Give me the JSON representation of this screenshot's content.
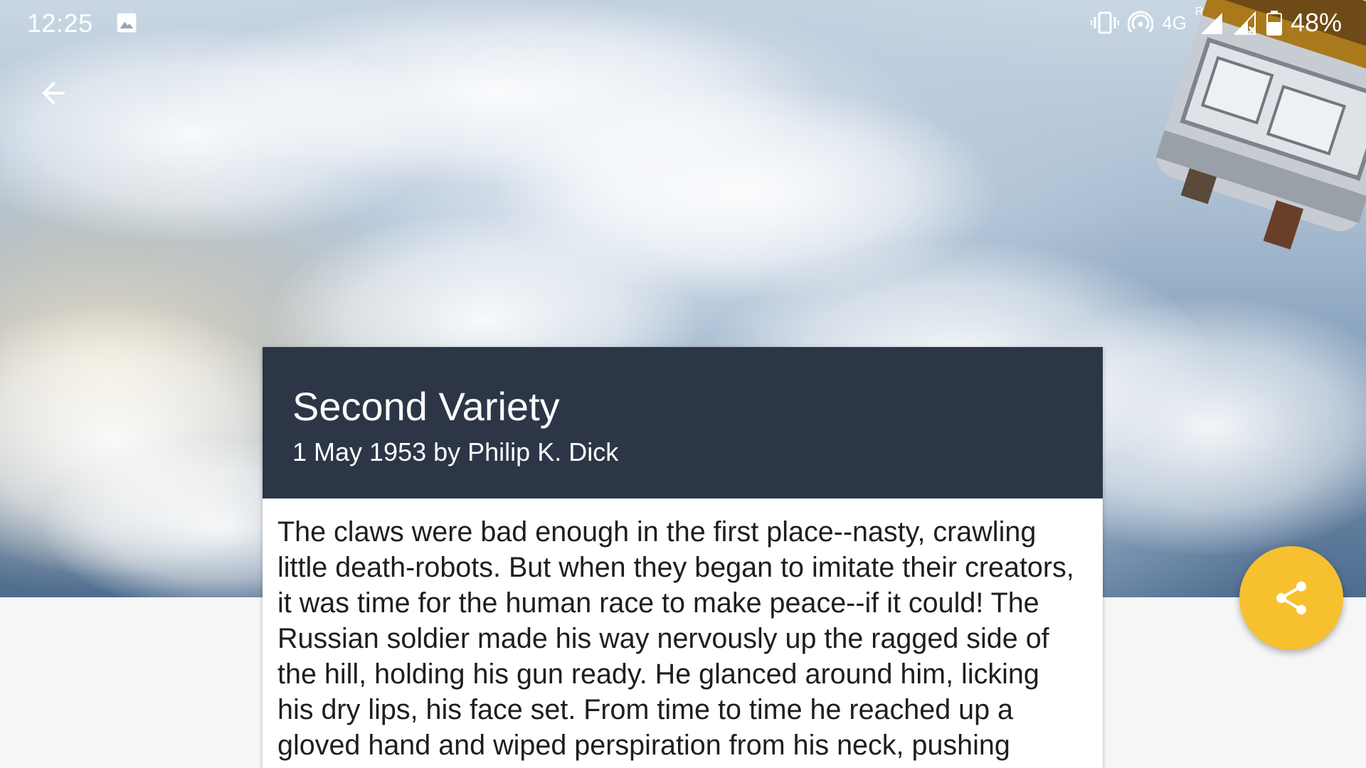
{
  "status_bar": {
    "time": "12:25",
    "network": "4G",
    "roaming_indicator": "R",
    "battery_percent": "48%",
    "icons": [
      "gallery-icon",
      "vibrate-icon",
      "hotspot-icon",
      "signal-icon",
      "signal-no-data-icon",
      "battery-icon"
    ]
  },
  "toolbar": {
    "back_icon": "arrow-back-icon"
  },
  "story": {
    "title": "Second Variety",
    "subtitle": "1 May 1953 by Philip K. Dick",
    "body": "The claws were bad enough in the first place--nasty, crawling little death-robots. But when they began to imitate their creators, it was time for the human race to make peace--if it could! The Russian soldier made his way nervously up the ragged side of the hill, holding his gun ready. He glanced around him, licking his dry lips, his face set. From time to time he reached up a gloved hand and wiped perspiration from his neck, pushing down his coat collar."
  },
  "fab": {
    "icon": "share-icon"
  },
  "colors": {
    "card_header": "#2c3646",
    "fab": "#f7c02f",
    "background": "#f6f6f6"
  }
}
